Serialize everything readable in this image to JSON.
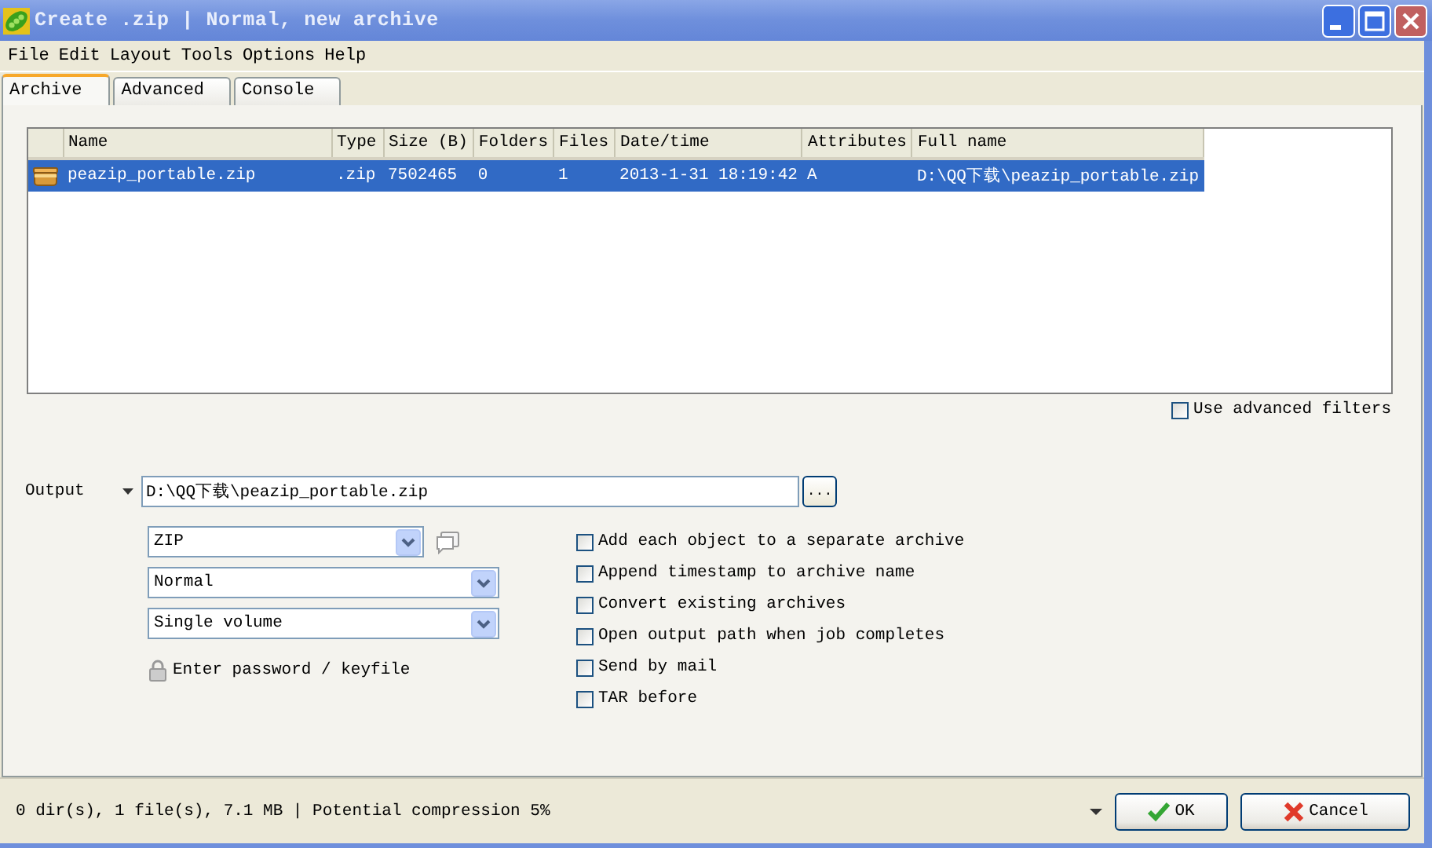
{
  "window": {
    "title": "Create .zip | Normal, new archive"
  },
  "menu": [
    "File",
    "Edit",
    "Layout",
    "Tools",
    "Options",
    "Help"
  ],
  "tabs": [
    {
      "label": "Archive",
      "selected": true
    },
    {
      "label": "Advanced",
      "selected": false
    },
    {
      "label": "Console",
      "selected": false
    }
  ],
  "table": {
    "columns": [
      "Name",
      "Type",
      "Size (B)",
      "Folders",
      "Files",
      "Date/time",
      "Attributes",
      "Full name"
    ],
    "rows": [
      {
        "selected": true,
        "cells": [
          "peazip_portable.zip",
          ".zip",
          "7502465",
          "0",
          "1",
          "2013-1-31 18:19:42",
          "A",
          "D:\\QQ下载\\peazip_portable.zip"
        ]
      }
    ]
  },
  "advanced_filters": {
    "label": "Use advanced filters",
    "checked": false
  },
  "output": {
    "label": "Output",
    "value": "D:\\QQ下载\\peazip_portable.zip",
    "browse": "..."
  },
  "format": {
    "value": "ZIP"
  },
  "compression_level": {
    "value": "Normal"
  },
  "volume": {
    "value": "Single volume"
  },
  "password": {
    "label": "Enter password / keyfile"
  },
  "options": [
    {
      "label": "Add each object to a separate archive",
      "checked": false
    },
    {
      "label": "Append timestamp to archive name",
      "checked": false
    },
    {
      "label": "Convert existing archives",
      "checked": false
    },
    {
      "label": "Open output path when job completes",
      "checked": false
    },
    {
      "label": "Send by mail",
      "checked": false
    },
    {
      "label": "TAR before",
      "checked": false
    }
  ],
  "status_bar": {
    "text": "0 dir(s), 1 file(s), 7.1 MB | Potential compression 5%"
  },
  "buttons": [
    {
      "kind": "ok",
      "label": "OK"
    },
    {
      "kind": "cancel",
      "label": "Cancel"
    }
  ]
}
